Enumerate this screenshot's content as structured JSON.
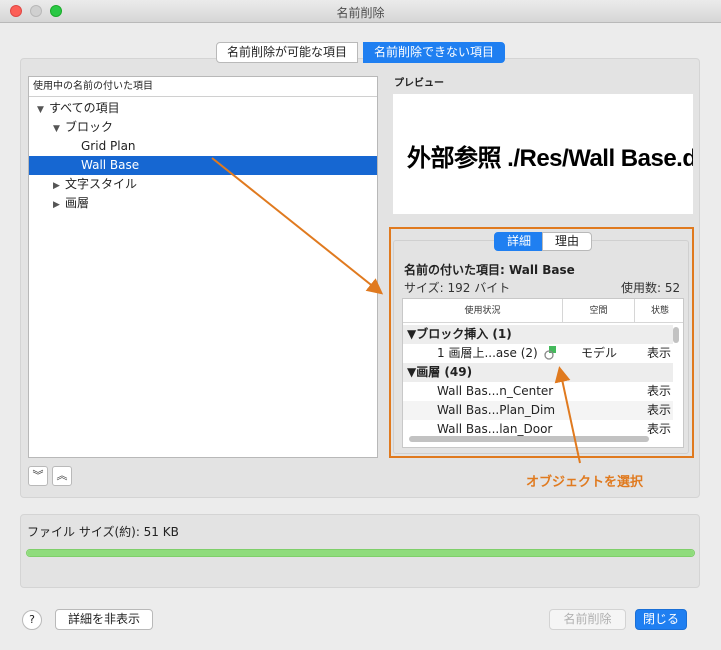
{
  "window": {
    "title": "名前削除"
  },
  "tabs": [
    "名前削除が可能な項目",
    "名前削除できない項目"
  ],
  "tree": {
    "header": "使用中の名前の付いた項目",
    "items": [
      {
        "label": "すべての項目",
        "tri": "▼",
        "indent": 0
      },
      {
        "label": "ブロック",
        "tri": "▼",
        "indent": 1
      },
      {
        "label": "Grid Plan",
        "tri": "",
        "indent": 2
      },
      {
        "label": "Wall Base",
        "tri": "",
        "indent": 2,
        "selected": true
      },
      {
        "label": "文字スタイル",
        "tri": "▶",
        "indent": 1
      },
      {
        "label": "画層",
        "tri": "▶",
        "indent": 1
      }
    ]
  },
  "preview": {
    "label": "プレビュー",
    "text": "外部参照 ./Res/Wall Base.d"
  },
  "detail": {
    "tabs": [
      "詳細",
      "理由"
    ],
    "named": "名前の付いた項目: Wall Base",
    "size": "サイズ: 192 バイト",
    "usecount": "使用数: 52",
    "table": {
      "columns": [
        "使用状況",
        "空間",
        "状態"
      ],
      "rows": [
        {
          "label": "▼ブロック挿入 (1)",
          "group": true
        },
        {
          "label": "1 画層上...ase (2)",
          "space": "モデル",
          "state": "表示"
        },
        {
          "label": "▼画層 (49)",
          "group": true
        },
        {
          "label": "Wall Bas...n_Center",
          "space": "",
          "state": "表示"
        },
        {
          "label": "Wall Bas...Plan_Dim",
          "space": "",
          "state": "表示"
        },
        {
          "label": "Wall Bas...lan_Door",
          "space": "",
          "state": "表示"
        }
      ]
    }
  },
  "annotation": "オブジェクトを選択",
  "file": {
    "label": "ファイル サイズ(約): 51 KB",
    "progress_fraction": 1.0
  },
  "buttons": {
    "help": "?",
    "detail": "詳細を非表示",
    "purge": "名前削除",
    "close": "閉じる"
  },
  "colors": {
    "accent": "#1f7ff1",
    "annotation": "#e07a1f",
    "selection": "#1667d2"
  }
}
